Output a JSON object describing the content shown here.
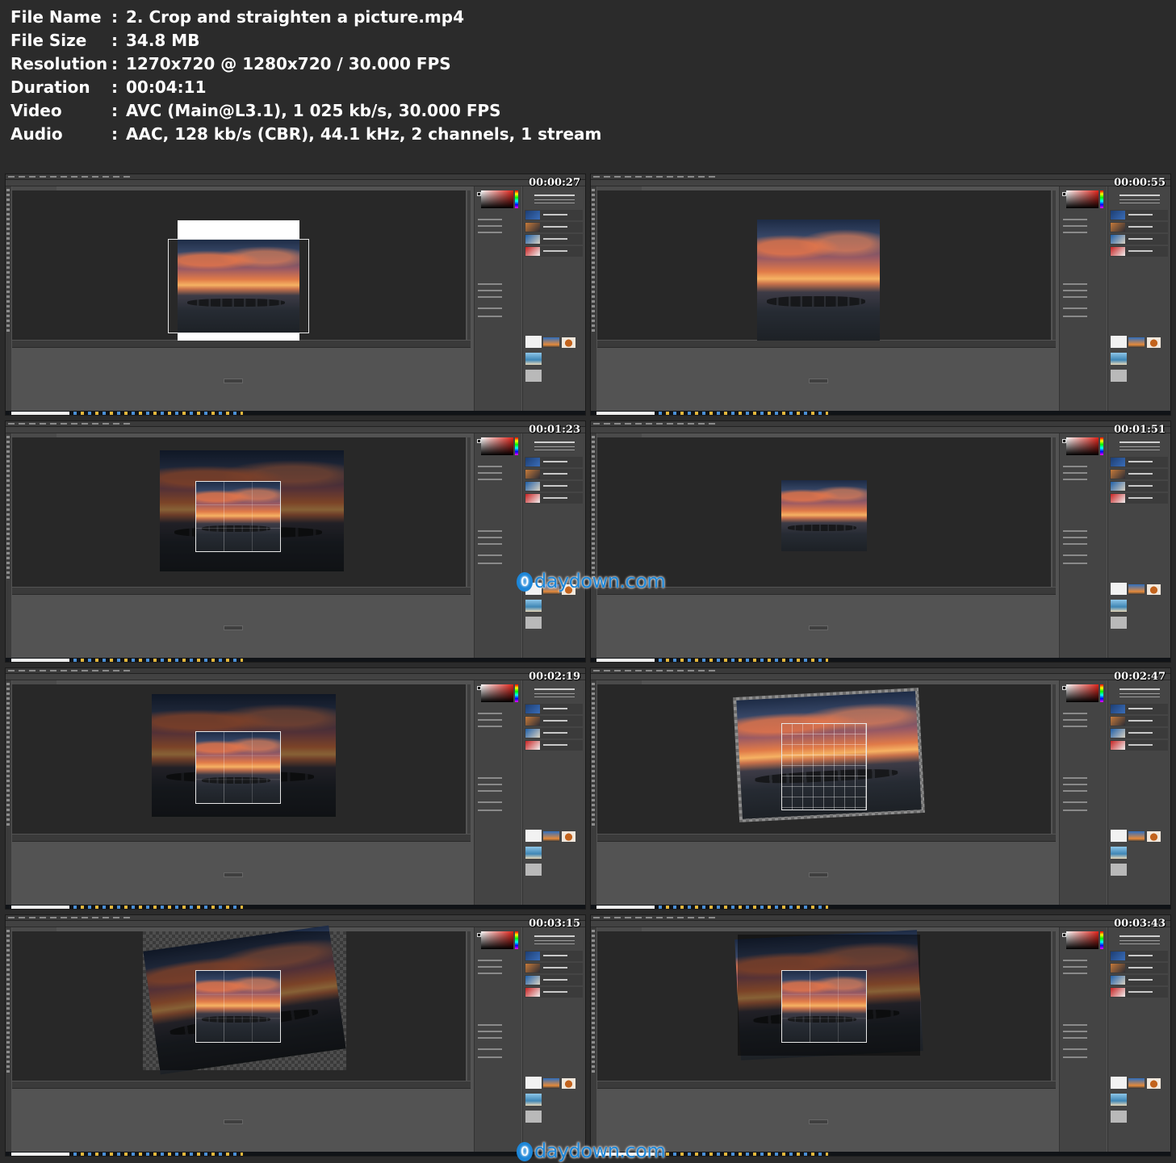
{
  "file_info": {
    "separator": ":",
    "rows": [
      {
        "key": "File Name",
        "value": "2. Crop and straighten a picture.mp4"
      },
      {
        "key": "File Size",
        "value": "34.8 MB"
      },
      {
        "key": "Resolution",
        "value": "1270x720 @ 1280x720 / 30.000 FPS"
      },
      {
        "key": "Duration",
        "value": "00:04:11"
      },
      {
        "key": "Video",
        "value": "AVC (Main@L3.1), 1 025 kb/s, 30.000 FPS"
      },
      {
        "key": "Audio",
        "value": "AAC, 128 kb/s (CBR), 44.1 kHz, 2 channels, 1 stream"
      }
    ]
  },
  "thumbnails": [
    {
      "timestamp": "00:00:27"
    },
    {
      "timestamp": "00:00:55"
    },
    {
      "timestamp": "00:01:23"
    },
    {
      "timestamp": "00:01:51"
    },
    {
      "timestamp": "00:02:19"
    },
    {
      "timestamp": "00:02:47"
    },
    {
      "timestamp": "00:03:15"
    },
    {
      "timestamp": "00:03:43"
    }
  ],
  "watermark": {
    "logo_char": "0",
    "text": "daydown.com"
  },
  "colors": {
    "background": "#2b2b2b",
    "workspace": "#535353",
    "canvas": "#282828",
    "watermark": "#1c86d8"
  }
}
